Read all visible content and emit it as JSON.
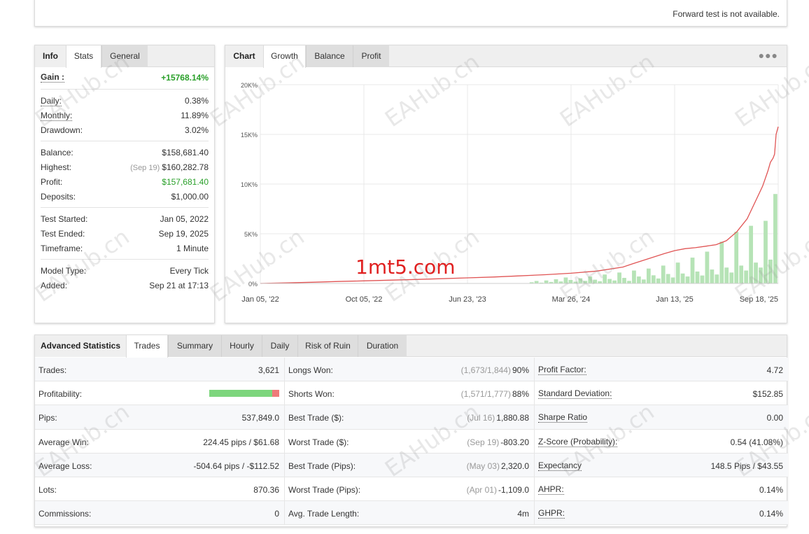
{
  "forward_test": {
    "message": "Forward test is not available."
  },
  "info_panel": {
    "tabs": [
      "Info",
      "Stats",
      "General"
    ],
    "gain": {
      "label": "Gain :",
      "value": "+15768.14%"
    },
    "group1": [
      {
        "label": "Daily:",
        "value": "0.38%"
      },
      {
        "label": "Monthly:",
        "value": "11.89%"
      },
      {
        "label": "Drawdown:",
        "value": "3.02%"
      }
    ],
    "group2": [
      {
        "label": "Balance:",
        "value": "$158,681.40"
      },
      {
        "label": "Highest:",
        "note": "(Sep 19)",
        "value": "$160,282.78"
      },
      {
        "label": "Profit:",
        "value": "$157,681.40"
      },
      {
        "label": "Deposits:",
        "value": "$1,000.00"
      }
    ],
    "group3": [
      {
        "label": "Test Started:",
        "value": "Jan 05, 2022"
      },
      {
        "label": "Test Ended:",
        "value": "Sep 19, 2025"
      },
      {
        "label": "Timeframe:",
        "value": "1 Minute"
      }
    ],
    "group4": [
      {
        "label": "Model Type:",
        "value": "Every Tick"
      },
      {
        "label": "Added:",
        "value": "Sep 21 at 17:13"
      }
    ]
  },
  "chart_panel": {
    "tabs": [
      "Chart",
      "Growth",
      "Balance",
      "Profit"
    ],
    "menu_icon": "ellipsis-icon",
    "brand_overlay": "1mt5.com"
  },
  "chart_data": {
    "type": "line",
    "y_tick_labels": [
      "0%",
      "5K%",
      "10K%",
      "15K%",
      "20K%"
    ],
    "x_tick_labels": [
      "Jan 05, '22",
      "Oct 05, '22",
      "Jun 23, '23",
      "Mar 26, '24",
      "Jan 13, '25",
      "Sep 18, '25"
    ],
    "ylim": [
      0,
      20000
    ],
    "grid": true,
    "colors": {
      "growth_line": "#e05454",
      "volume_bars": "#b6e3b6",
      "grid": "#e8e8e8"
    },
    "series": [
      {
        "type": "line",
        "x": [
          0,
          0.05,
          0.1,
          0.15,
          0.2,
          0.25,
          0.3,
          0.35,
          0.4,
          0.45,
          0.5,
          0.55,
          0.6,
          0.65,
          0.7,
          0.72,
          0.75,
          0.78,
          0.8,
          0.82,
          0.84,
          0.86,
          0.88,
          0.9,
          0.92,
          0.94,
          0.95,
          0.96,
          0.97,
          0.98,
          0.985,
          0.99,
          0.993,
          0.996,
          1.0
        ],
        "values": [
          0,
          60,
          120,
          200,
          260,
          330,
          400,
          480,
          560,
          650,
          760,
          880,
          1030,
          1250,
          1650,
          2000,
          2500,
          3000,
          3300,
          3500,
          3600,
          3750,
          3900,
          4300,
          5200,
          6500,
          7600,
          8700,
          9800,
          11300,
          12200,
          12600,
          13000,
          15000,
          15768
        ]
      },
      {
        "type": "volume_bars",
        "x_start": 0.52,
        "values": [
          120,
          250,
          80,
          300,
          150,
          420,
          200,
          600,
          350,
          180,
          520,
          260,
          700,
          380,
          220,
          900,
          450,
          300,
          1100,
          560,
          260,
          1300,
          700,
          400,
          1500,
          820,
          500,
          1800,
          950,
          600,
          2100,
          1000,
          700,
          2600,
          1200,
          800,
          3200,
          1400,
          900,
          4200,
          1600,
          1100,
          5200,
          1800,
          1300,
          5800,
          2100,
          1600,
          6300,
          2400,
          9000
        ]
      }
    ]
  },
  "advanced_stats": {
    "title": "Advanced Statistics",
    "tabs": [
      "Trades",
      "Summary",
      "Hourly",
      "Daily",
      "Risk of Ruin",
      "Duration"
    ],
    "profitability_fraction": 0.9,
    "rows": [
      [
        {
          "label": "Trades:",
          "value": "3,621"
        },
        {
          "label": "Longs Won:",
          "note": "(1,673/1,844)",
          "value": "90%"
        },
        {
          "label": "Profit Factor:",
          "value": "4.72",
          "underline": true
        }
      ],
      [
        {
          "label": "Profitability:",
          "bar": true
        },
        {
          "label": "Shorts Won:",
          "note": "(1,571/1,777)",
          "value": "88%"
        },
        {
          "label": "Standard Deviation:",
          "value": "$152.85",
          "underline": true
        }
      ],
      [
        {
          "label": "Pips:",
          "value": "537,849.0"
        },
        {
          "label": "Best Trade ($):",
          "note": "(Jul 16)",
          "value": "1,880.88"
        },
        {
          "label": "Sharpe Ratio",
          "value": "0.00",
          "underline": true
        }
      ],
      [
        {
          "label": "Average Win:",
          "value": "224.45 pips / $61.68"
        },
        {
          "label": "Worst Trade ($):",
          "note": "(Sep 19)",
          "value": "-803.20"
        },
        {
          "label": "Z-Score (Probability):",
          "value": "0.54 (41.08%)",
          "underline": true
        }
      ],
      [
        {
          "label": "Average Loss:",
          "value": "-504.64 pips / -$112.52"
        },
        {
          "label": "Best Trade (Pips):",
          "note": "(May 03)",
          "value": "2,320.0"
        },
        {
          "label": "Expectancy",
          "value": "148.5 Pips / $43.55",
          "underline": true
        }
      ],
      [
        {
          "label": "Lots:",
          "value": "870.36"
        },
        {
          "label": "Worst Trade (Pips):",
          "note": "(Apr 01)",
          "value": "-1,109.0"
        },
        {
          "label": "AHPR:",
          "value": "0.14%",
          "underline": true
        }
      ],
      [
        {
          "label": "Commissions:",
          "value": "0"
        },
        {
          "label": "Avg. Trade Length:",
          "value": "4m"
        },
        {
          "label": "GHPR:",
          "value": "0.14%",
          "underline": true
        }
      ]
    ]
  },
  "watermark_text": "EAHub.cn"
}
